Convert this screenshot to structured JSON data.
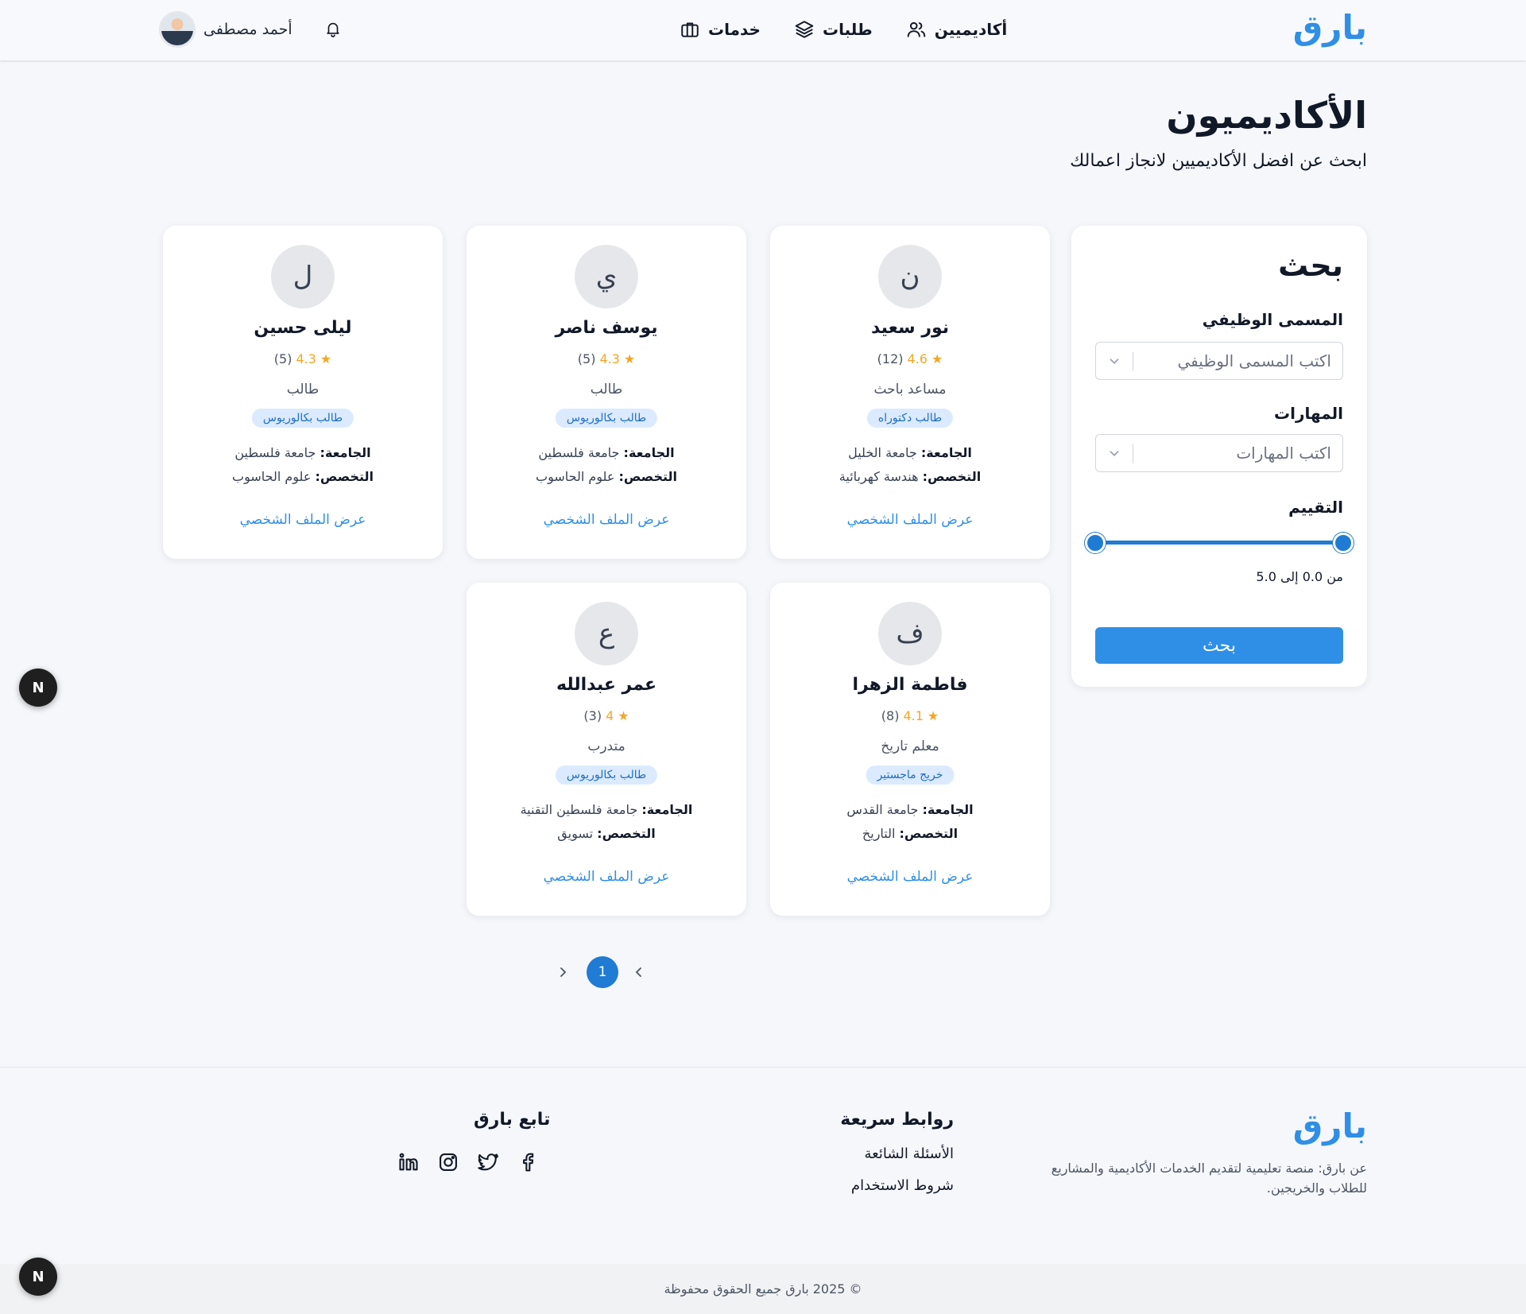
{
  "header": {
    "brand": "بارق",
    "nav": [
      {
        "label": "خدمات",
        "icon": "briefcase-icon"
      },
      {
        "label": "طلبات",
        "icon": "layers-icon"
      },
      {
        "label": "أكاديميين",
        "icon": "users-icon"
      }
    ],
    "user_name": "أحمد مصطفى"
  },
  "page": {
    "title": "الأكاديميون",
    "subtitle": "ابحث عن افضل الأكاديميين لانجاز اعمالك"
  },
  "search": {
    "title": "بحث",
    "job_title_label": "المسمى الوظيفي",
    "job_title_placeholder": "اكتب المسمى الوظيفي",
    "skills_label": "المهارات",
    "skills_placeholder": "اكتب المهارات",
    "rating_label": "التقييم",
    "rating_min": 0.0,
    "rating_max": 5.0,
    "range_text": "من 0.0 إلى 5.0",
    "button": "بحث"
  },
  "labels": {
    "university": "الجامعة:",
    "specialization": "التخصص:",
    "view_profile": "عرض الملف الشخصي"
  },
  "academics": [
    {
      "initial": "ن",
      "name": "نور سعيد",
      "rating": "4.6",
      "reviews": "(12)",
      "role": "مساعد باحث",
      "badge": "طالب دكتوراه",
      "university": "جامعة الخليل",
      "specialization": "هندسة كهربائية"
    },
    {
      "initial": "ي",
      "name": "يوسف ناصر",
      "rating": "4.3",
      "reviews": "(5)",
      "role": "طالب",
      "badge": "طالب بكالوريوس",
      "university": "جامعة فلسطين",
      "specialization": "علوم الحاسوب"
    },
    {
      "initial": "ل",
      "name": "ليلى حسين",
      "rating": "4.3",
      "reviews": "(5)",
      "role": "طالب",
      "badge": "طالب بكالوريوس",
      "university": "جامعة فلسطين",
      "specialization": "علوم الحاسوب"
    },
    {
      "initial": "ف",
      "name": "فاطمة الزهرا",
      "rating": "4.1",
      "reviews": "(8)",
      "role": "معلم تاريخ",
      "badge": "خريج ماجستير",
      "university": "جامعة القدس",
      "specialization": "التاريخ"
    },
    {
      "initial": "ع",
      "name": "عمر عبدالله",
      "rating": "4",
      "reviews": "(3)",
      "role": "متدرب",
      "badge": "طالب بكالوريوس",
      "university": "جامعة فلسطين التقنية",
      "specialization": "تسويق"
    }
  ],
  "pagination": {
    "current": "1"
  },
  "floating_badge": "N",
  "footer": {
    "brand": "بارق",
    "about": "عن بارق: منصة تعليمية لتقديم الخدمات الأكاديمية والمشاريع للطلاب والخريجين.",
    "quick_links_title": "روابط سريعة",
    "quick_links": [
      "الأسئلة الشائعة",
      "شروط الاستخدام"
    ],
    "follow_title": "تابع بارق",
    "socials": [
      "facebook-icon",
      "twitter-icon",
      "instagram-icon",
      "linkedin-icon"
    ],
    "copyright": "© 2025 بارق جميع الحقوق محفوظة"
  },
  "colors": {
    "brand": "#2f8fe6",
    "accent": "#1f7bd4",
    "star": "#f5a623",
    "badge_bg": "#dbeafe"
  }
}
